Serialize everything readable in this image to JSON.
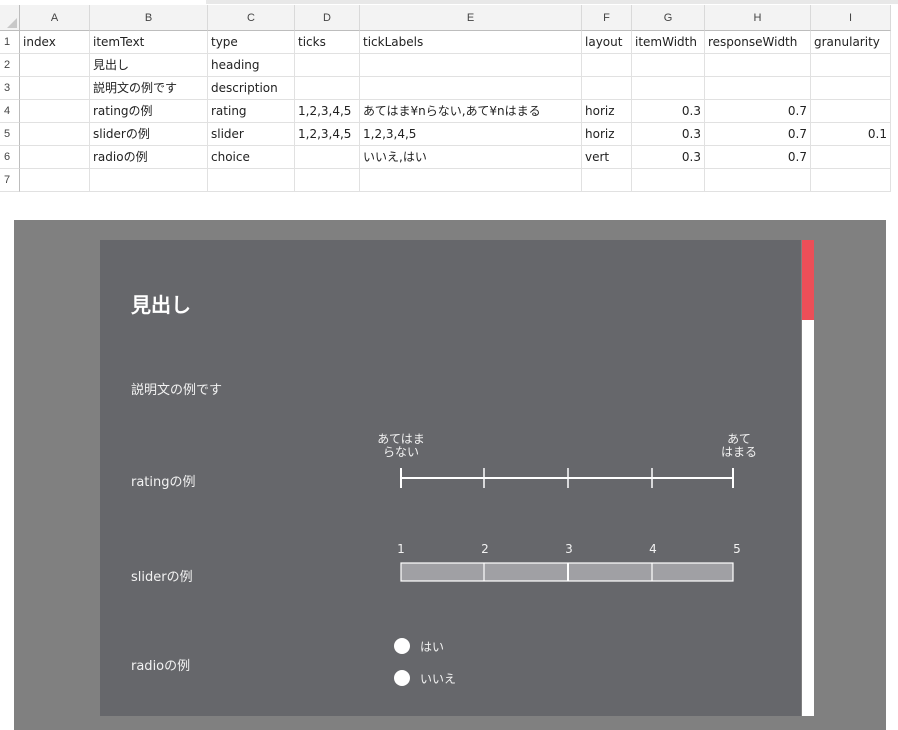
{
  "sheet": {
    "columns": [
      "A",
      "B",
      "C",
      "D",
      "E",
      "F",
      "G",
      "H",
      "I"
    ],
    "rows": [
      {
        "num": "1",
        "cells": [
          "index",
          "itemText",
          "type",
          "ticks",
          "tickLabels",
          "layout",
          "itemWidth",
          "responseWidth",
          "granularity"
        ]
      },
      {
        "num": "2",
        "cells": [
          "",
          "見出し",
          "heading",
          "",
          "",
          "",
          "",
          "",
          ""
        ]
      },
      {
        "num": "3",
        "cells": [
          "",
          "説明文の例です",
          "description",
          "",
          "",
          "",
          "",
          "",
          ""
        ]
      },
      {
        "num": "4",
        "cells": [
          "",
          "ratingの例",
          "rating",
          "1,2,3,4,5",
          "あてはま¥nらない,あて¥nはまる",
          "horiz",
          "0.3",
          "0.7",
          ""
        ]
      },
      {
        "num": "5",
        "cells": [
          "",
          "sliderの例",
          "slider",
          "1,2,3,4,5",
          "1,2,3,4,5",
          "horiz",
          "0.3",
          "0.7",
          "0.1"
        ]
      },
      {
        "num": "6",
        "cells": [
          "",
          "radioの例",
          "choice",
          "",
          "いいえ,はい",
          "vert",
          "0.3",
          "0.7",
          ""
        ]
      },
      {
        "num": "7",
        "cells": [
          "",
          "",
          "",
          "",
          "",
          "",
          "",
          "",
          ""
        ]
      }
    ]
  },
  "preview": {
    "heading": "見出し",
    "description": "説明文の例です",
    "rating": {
      "label": "ratingの例",
      "left_label_line1": "あてはま",
      "left_label_line2": "らない",
      "right_label_line1": "あて",
      "right_label_line2": "はまる",
      "ticks": 5
    },
    "slider": {
      "label": "sliderの例",
      "tick_labels": [
        "1",
        "2",
        "3",
        "4",
        "5"
      ]
    },
    "radio": {
      "label": "radioの例",
      "options": [
        "はい",
        "いいえ"
      ]
    },
    "colors": {
      "panel": "#66676b",
      "background": "#808080",
      "scrollbar_thumb": "#ec4f58"
    }
  }
}
